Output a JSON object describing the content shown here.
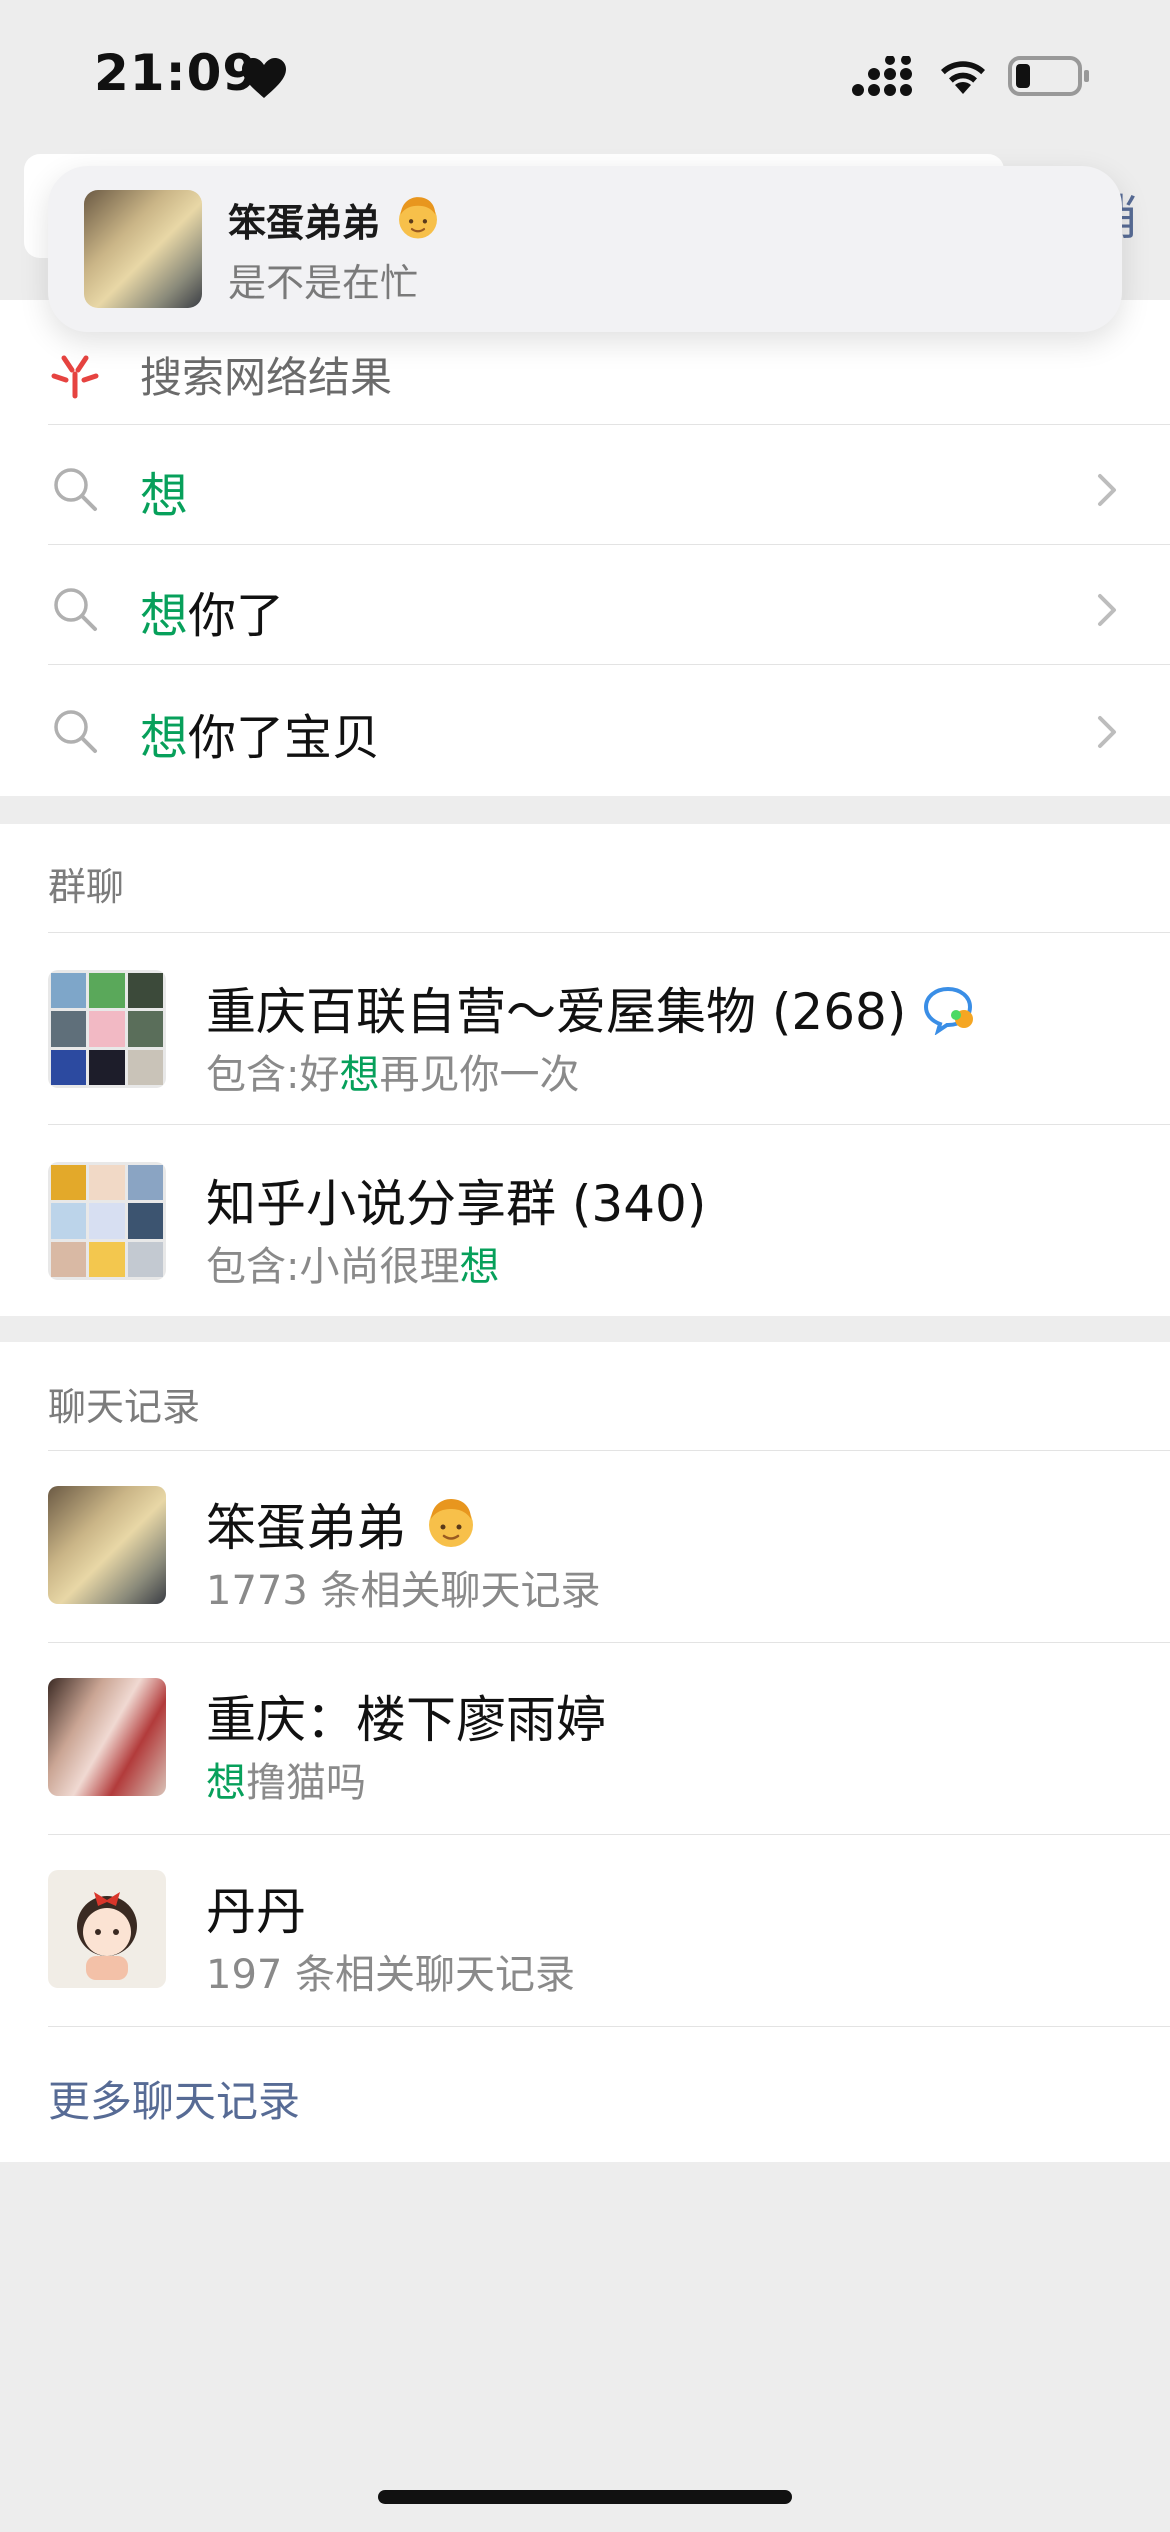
{
  "status_bar": {
    "time": "21:09",
    "heart_icon": "heart-icon",
    "signal_icon": "cellular-signal-icon",
    "wifi_icon": "wifi-icon",
    "battery_icon": "battery-low-icon"
  },
  "search": {
    "cancel_label": "消"
  },
  "notification": {
    "sender": "笨蛋弟弟",
    "message": "是不是在忙"
  },
  "web_search": {
    "label": "搜索网络结果",
    "suggestions": [
      {
        "highlight": "想",
        "rest": ""
      },
      {
        "highlight": "想",
        "rest": "你了"
      },
      {
        "highlight": "想",
        "rest": "你了宝贝"
      }
    ]
  },
  "group_chats": {
    "header": "群聊",
    "items": [
      {
        "title": "重庆百联自营～爱屋集物 (268)",
        "sub_prefix": "包含:好",
        "sub_highlight": "想",
        "sub_suffix": "再见你一次"
      },
      {
        "title": "知乎小说分享群 (340)",
        "sub_prefix": "包含:小尚很理",
        "sub_highlight": "想",
        "sub_suffix": ""
      }
    ]
  },
  "chat_records": {
    "header": "聊天记录",
    "items": [
      {
        "title": "笨蛋弟弟",
        "sub_prefix": "1773 条相关聊天记录",
        "sub_highlight": "",
        "sub_suffix": ""
      },
      {
        "title": "重庆：楼下廖雨婷",
        "sub_prefix": "",
        "sub_highlight": "想",
        "sub_suffix": "撸猫吗"
      },
      {
        "title": "丹丹",
        "sub_prefix": "197 条相关聊天记录",
        "sub_highlight": "",
        "sub_suffix": ""
      }
    ],
    "more_label": "更多聊天记录"
  },
  "colors": {
    "highlight": "#07a05b",
    "link": "#576b95",
    "background": "#ededed"
  }
}
